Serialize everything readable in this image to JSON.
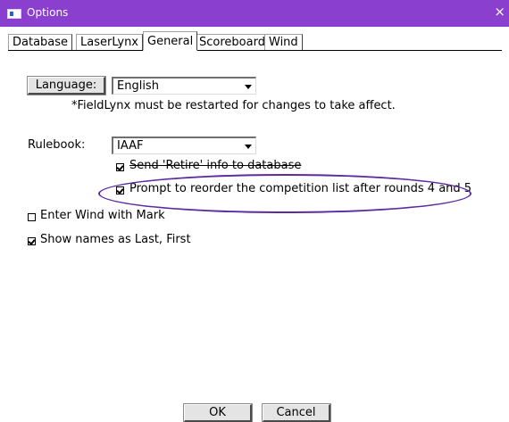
{
  "window": {
    "title": "Options",
    "close_glyph": "×"
  },
  "tabs": [
    {
      "label": "Database"
    },
    {
      "label": "LaserLynx"
    },
    {
      "label": "General",
      "active": true
    },
    {
      "label": "Scoreboard"
    },
    {
      "label": "Wind"
    }
  ],
  "language": {
    "button_label": "Language:",
    "selected": "English",
    "note": "*FieldLynx must be restarted for changes to take affect."
  },
  "rulebook": {
    "label": "Rulebook:",
    "selected": "IAAF"
  },
  "options": {
    "send_retire": {
      "label": "Send 'Retire' info to database",
      "checked": true
    },
    "prompt_reorder": {
      "label": "Prompt to reorder the competition list after rounds 4 and 5",
      "checked": true
    },
    "enter_wind": {
      "label": "Enter Wind with Mark",
      "checked": false
    },
    "show_names": {
      "label": "Show names as Last, First",
      "checked": true
    }
  },
  "footer": {
    "ok_label": "OK",
    "cancel_label": "Cancel"
  },
  "colors": {
    "titlebar": "#8b3fcf",
    "annotation": "#5d2aa0"
  }
}
